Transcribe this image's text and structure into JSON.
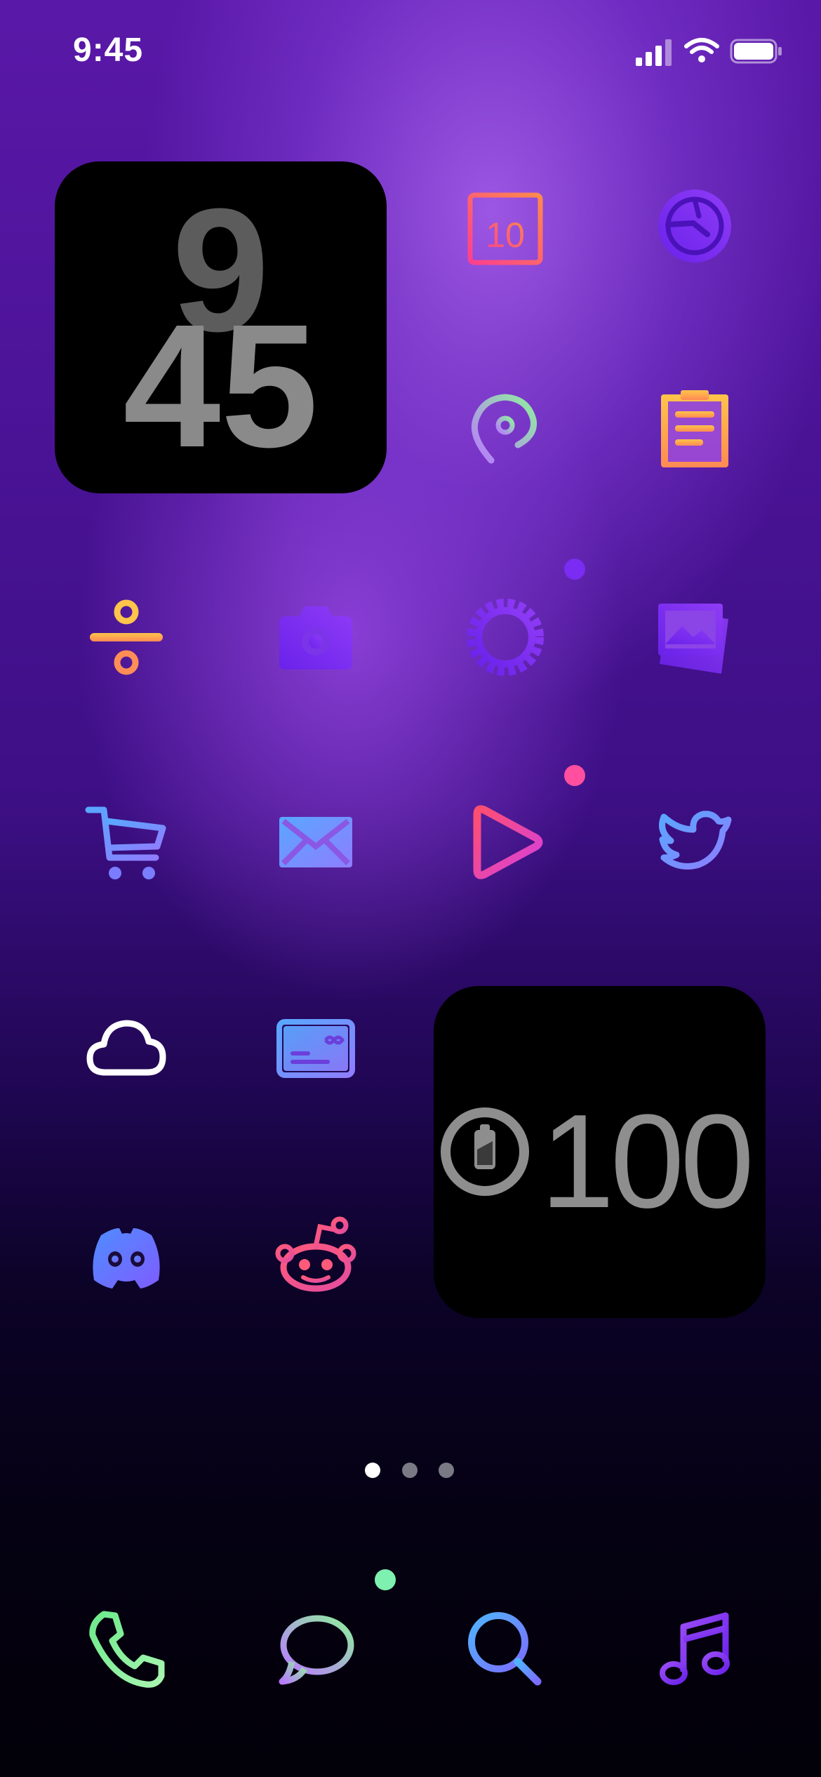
{
  "status_bar": {
    "time": "9:45"
  },
  "widgets": {
    "clock": {
      "hour": "9",
      "minute": "45"
    },
    "battery": {
      "value": "100"
    }
  },
  "apps": [
    {
      "name": "calendar-icon",
      "calendar_day": "10"
    },
    {
      "name": "safari-icon"
    },
    {
      "name": "maps-icon"
    },
    {
      "name": "notes-icon"
    },
    {
      "name": "calculator-icon"
    },
    {
      "name": "camera-icon"
    },
    {
      "name": "settings-icon"
    },
    {
      "name": "photos-icon"
    },
    {
      "name": "shopping-cart-icon"
    },
    {
      "name": "mail-icon"
    },
    {
      "name": "play-icon"
    },
    {
      "name": "twitter-icon"
    },
    {
      "name": "cloud-icon"
    },
    {
      "name": "wallet-icon"
    },
    {
      "name": "discord-icon"
    },
    {
      "name": "reddit-icon"
    }
  ],
  "dock": [
    {
      "name": "phone-icon"
    },
    {
      "name": "messages-icon"
    },
    {
      "name": "search-icon"
    },
    {
      "name": "music-icon"
    }
  ],
  "page_indicator": {
    "pages": 3,
    "current": 1
  },
  "colors": {
    "accent_pink": "#ff4f7b",
    "accent_purple": "#7a2cf2",
    "accent_orange": "#ff9a3c",
    "accent_green": "#8cf0a6",
    "accent_blue": "#5aa0ff"
  }
}
